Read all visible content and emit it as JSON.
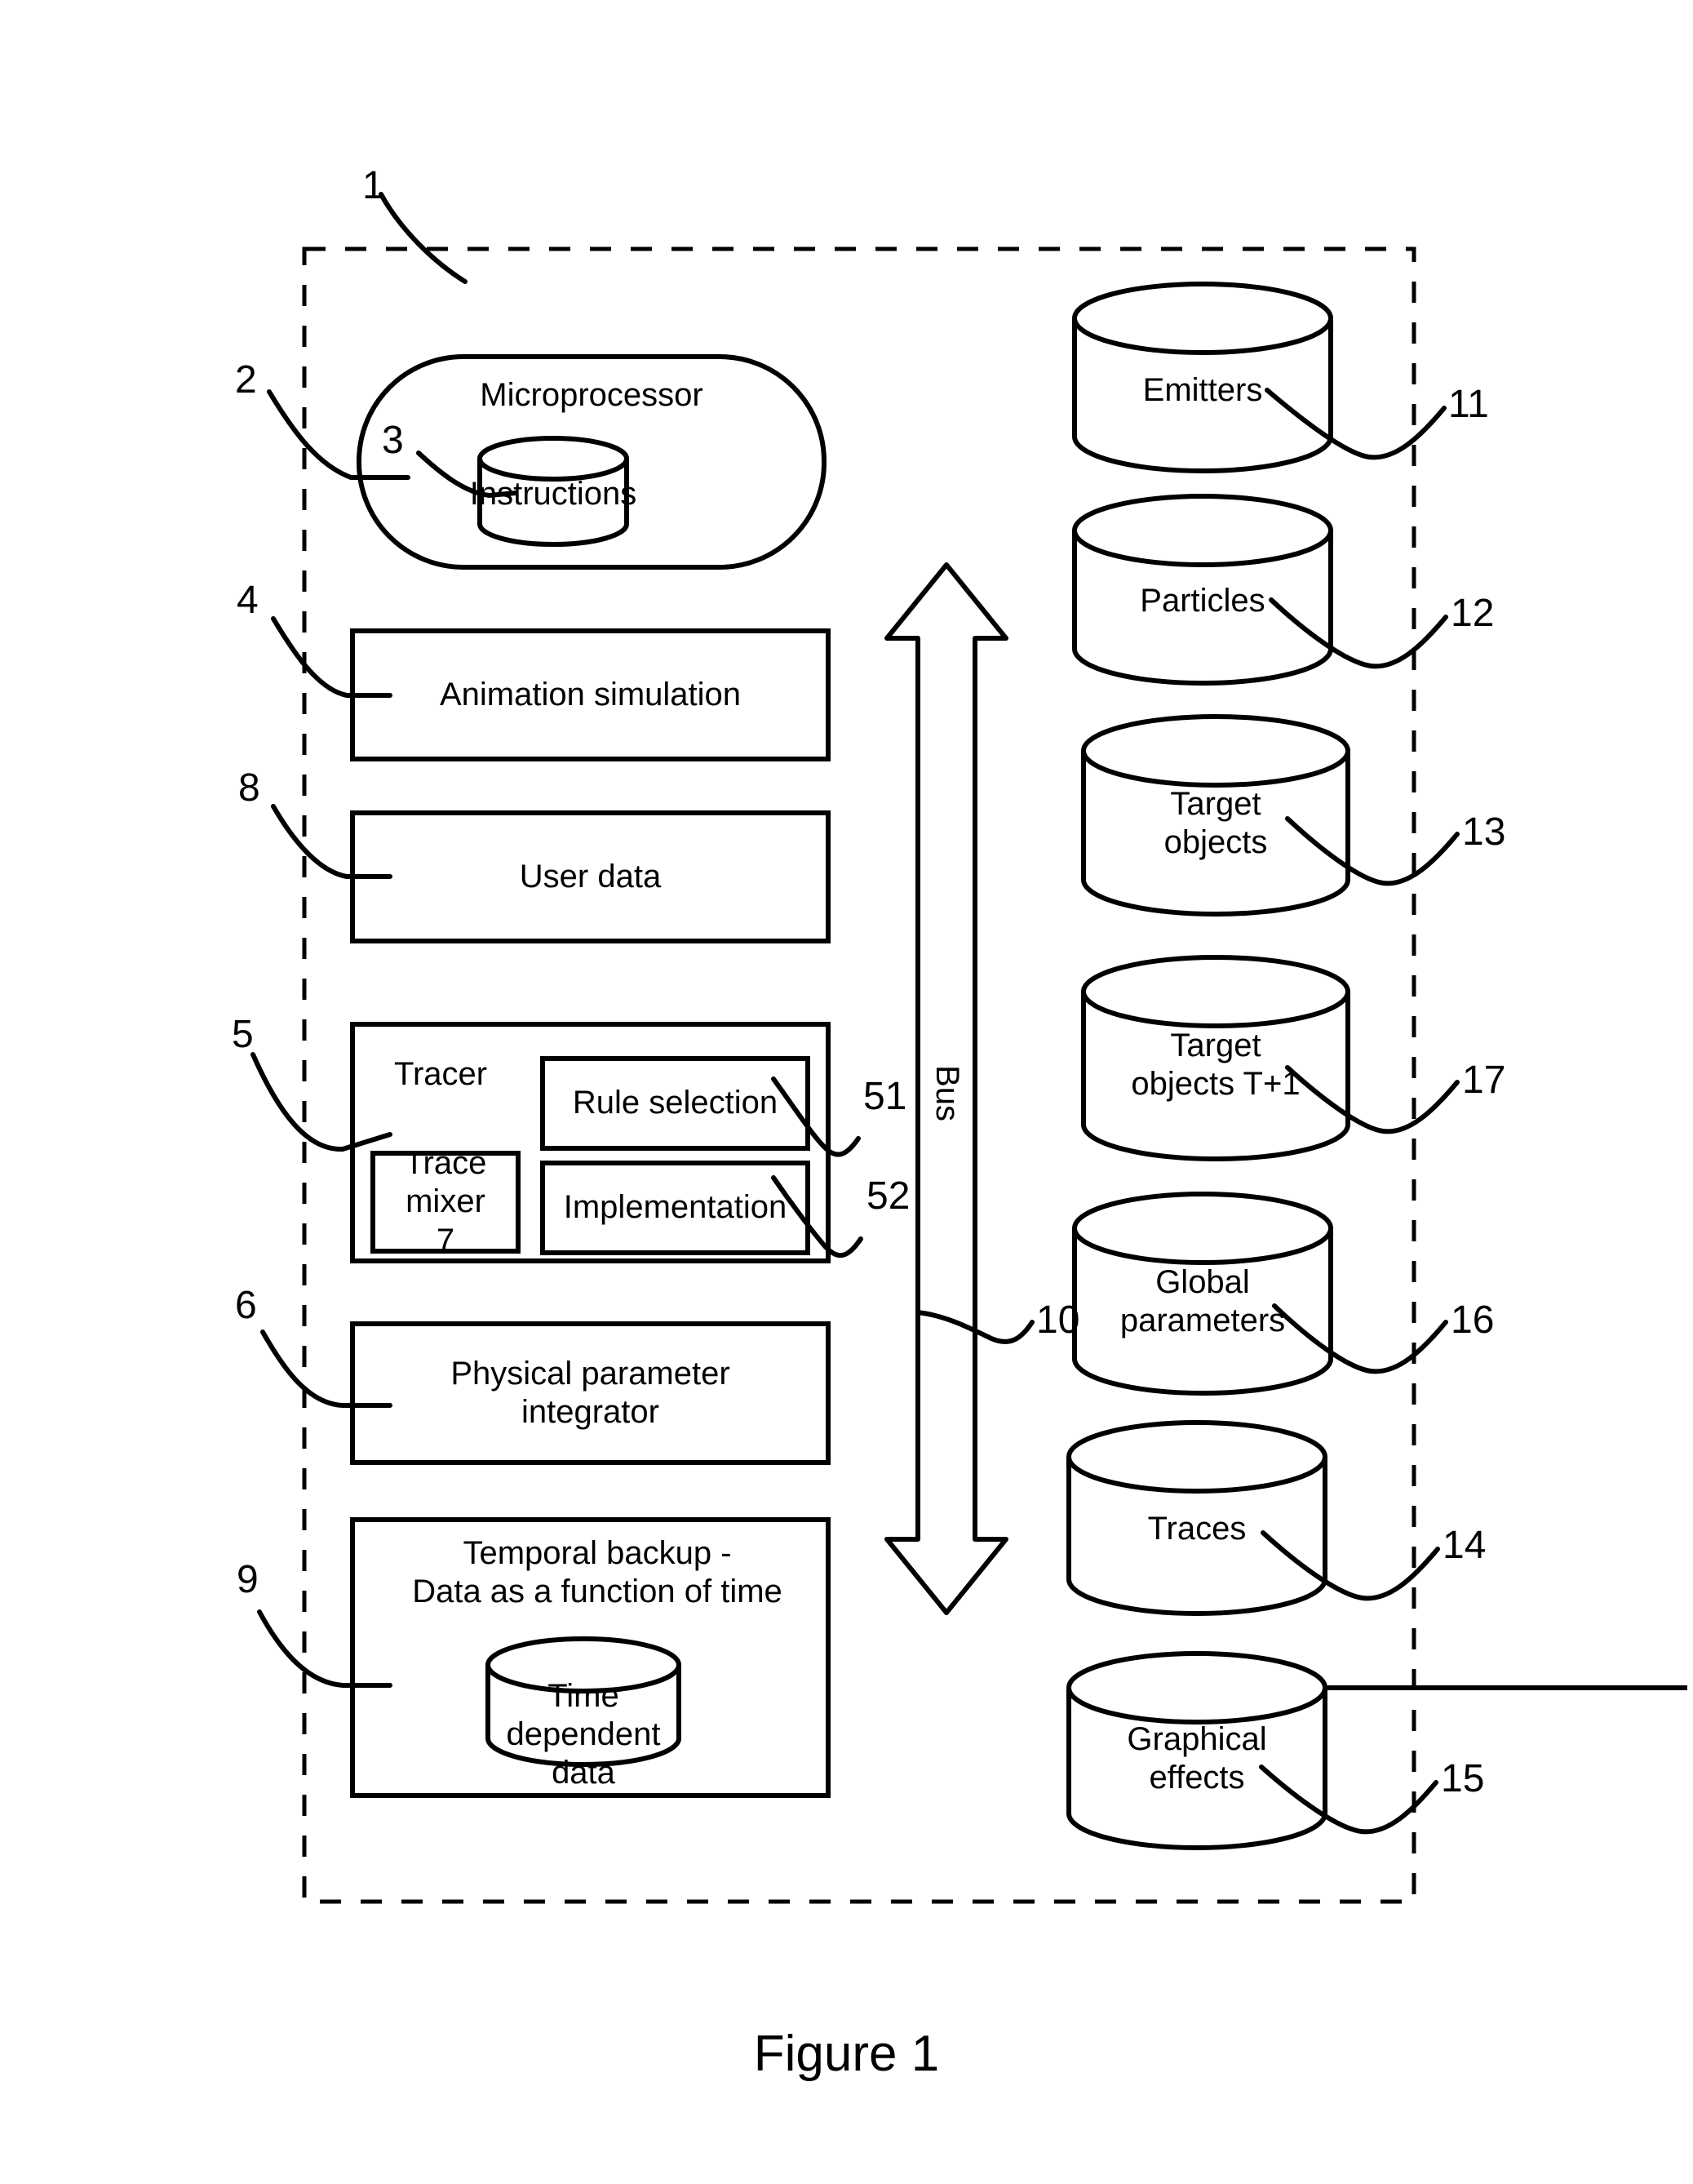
{
  "figure": {
    "caption": "Figure 1",
    "system_ref": "1"
  },
  "system_boundary": {
    "style": "dashed",
    "ref": "1"
  },
  "left_column": {
    "microprocessor": {
      "label": "Microprocessor",
      "ref": "2",
      "inner_cylinder": {
        "label": "Instructions",
        "ref": "3"
      }
    },
    "blocks": [
      {
        "label": "Animation simulation",
        "ref": "4"
      },
      {
        "label": "User data",
        "ref": "8"
      }
    ],
    "tracer": {
      "label": "Tracer",
      "ref": "5",
      "trace_mixer": {
        "line1": "Trace",
        "line2": "mixer",
        "ref": "7"
      },
      "sub_blocks": [
        {
          "label": "Rule selection",
          "ref": "51"
        },
        {
          "label": "Implementation",
          "ref": "52"
        }
      ]
    },
    "physical_parameter_integrator": {
      "line1": "Physical parameter",
      "line2": "integrator",
      "ref": "6"
    },
    "temporal_backup": {
      "line1": "Temporal backup -",
      "line2": "Data as a function of time",
      "ref": "9",
      "inner_cylinder": {
        "line1": "Time",
        "line2": "dependent",
        "line3": "data"
      }
    }
  },
  "bus": {
    "label": "Bus",
    "ref": "10",
    "direction": "bidirectional-vertical"
  },
  "databases": [
    {
      "label": "Emitters",
      "line1": "Emitters",
      "line2": "",
      "ref": "11"
    },
    {
      "label": "Particles",
      "line1": "Particles",
      "line2": "",
      "ref": "12"
    },
    {
      "label": "Target objects",
      "line1": "Target",
      "line2": "objects",
      "ref": "13"
    },
    {
      "label": "Target objects T+1",
      "line1": "Target",
      "line2": "objects T+1",
      "ref": "17"
    },
    {
      "label": "Global parameters",
      "line1": "Global",
      "line2": "parameters",
      "ref": "16"
    },
    {
      "label": "Traces",
      "line1": "Traces",
      "line2": "",
      "ref": "14"
    },
    {
      "label": "Graphical effects",
      "line1": "Graphical",
      "line2": "effects",
      "ref": "15"
    }
  ],
  "colors": {
    "stroke": "#000000",
    "background": "#ffffff"
  }
}
